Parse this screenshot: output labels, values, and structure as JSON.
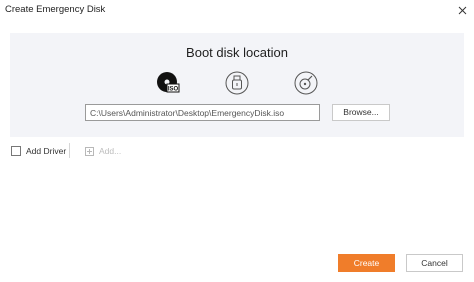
{
  "window": {
    "title": "Create Emergency Disk"
  },
  "panel": {
    "title": "Boot disk location",
    "media_options": [
      {
        "name": "iso",
        "label": "ISO",
        "selected": true
      },
      {
        "name": "usb",
        "selected": false
      },
      {
        "name": "cd-dvd",
        "selected": false
      }
    ],
    "path_value": "C:\\Users\\Administrator\\Desktop\\EmergencyDisk.iso",
    "browse_label": "Browse..."
  },
  "driver": {
    "add_driver_label": "Add Driver",
    "add_driver_checked": false,
    "add_label": "Add..."
  },
  "footer": {
    "create_label": "Create",
    "cancel_label": "Cancel"
  },
  "colors": {
    "accent": "#f07d2a",
    "panel_bg": "#f3f4f8"
  }
}
